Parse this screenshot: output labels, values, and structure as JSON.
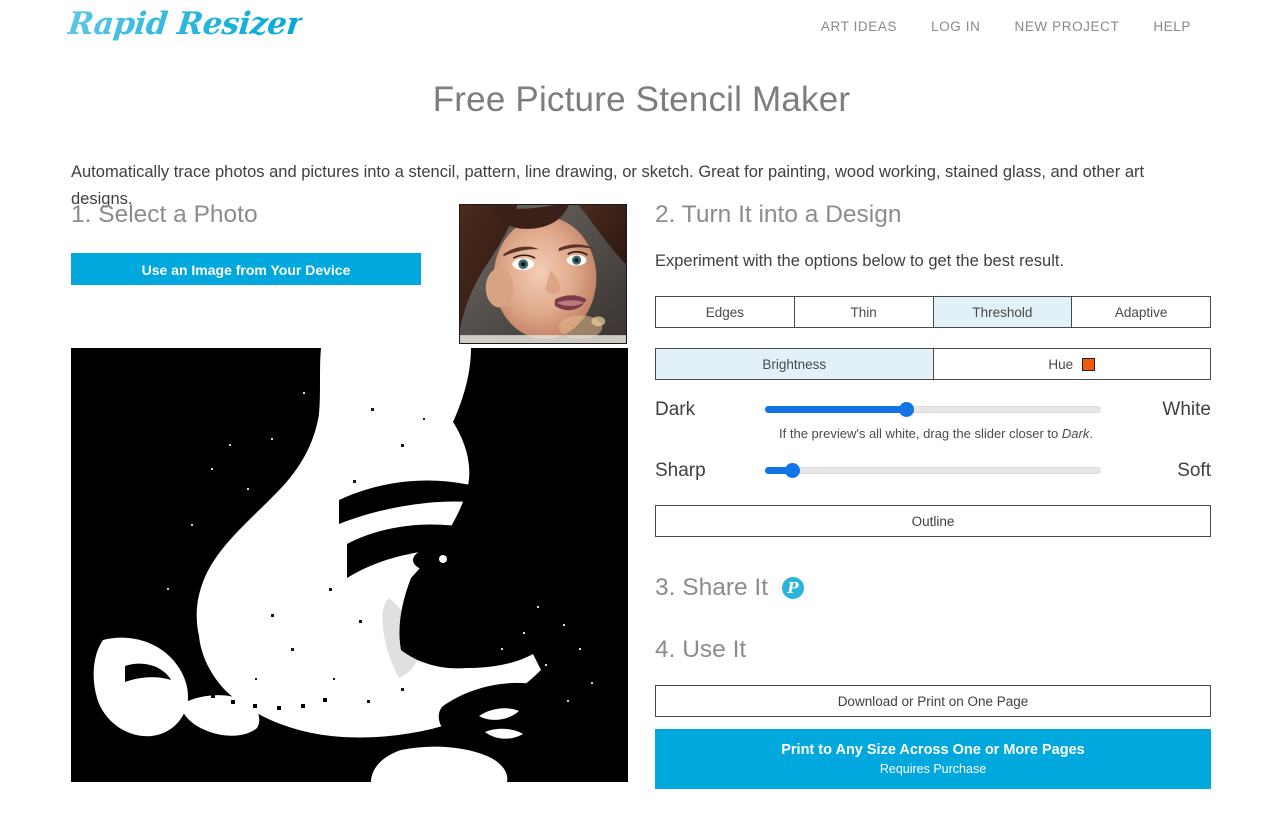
{
  "header": {
    "logo": "Rapid Resizer",
    "nav": [
      {
        "label": "ART IDEAS"
      },
      {
        "label": "LOG IN"
      },
      {
        "label": "NEW PROJECT"
      },
      {
        "label": "HELP"
      }
    ]
  },
  "page": {
    "title": "Free Picture Stencil Maker",
    "intro": "Automatically trace photos and pictures into a stencil, pattern, line drawing, or sketch. Great for painting, wood working, stained glass, and other art designs."
  },
  "step1": {
    "heading": "1. Select a Photo",
    "upload_button": "Use an Image from Your Device"
  },
  "step2": {
    "heading": "2. Turn It into a Design",
    "subtitle": "Experiment with the options below to get the best result.",
    "mode_tabs": [
      {
        "label": "Edges",
        "selected": false
      },
      {
        "label": "Thin",
        "selected": false
      },
      {
        "label": "Threshold",
        "selected": true
      },
      {
        "label": "Adaptive",
        "selected": false
      }
    ],
    "channel_tabs": [
      {
        "label": "Brightness",
        "selected": true
      },
      {
        "label": "Hue",
        "selected": false,
        "swatch_color": "#ef5a0c"
      }
    ],
    "slider_threshold": {
      "left_label": "Dark",
      "right_label": "White",
      "value_percent": 42,
      "hint_before": "If the preview's all white, drag the slider closer to ",
      "hint_emphasis": "Dark",
      "hint_after": "."
    },
    "slider_smoothing": {
      "left_label": "Sharp",
      "right_label": "Soft",
      "value_percent": 8
    },
    "outline_button": "Outline"
  },
  "step3": {
    "heading": "3. Share It",
    "pinterest_glyph": "P"
  },
  "step4": {
    "heading": "4. Use It",
    "download_button": "Download or Print on One Page",
    "print_button_line1": "Print to Any Size Across One or More Pages",
    "print_button_line2": "Requires Purchase"
  },
  "colors": {
    "brand_cyan": "#00a8dd",
    "selected_tab": "#e1f1f7",
    "slider_blue": "#1273e6",
    "hue_swatch": "#ef5a0c",
    "pinterest": "#29b3dd"
  }
}
